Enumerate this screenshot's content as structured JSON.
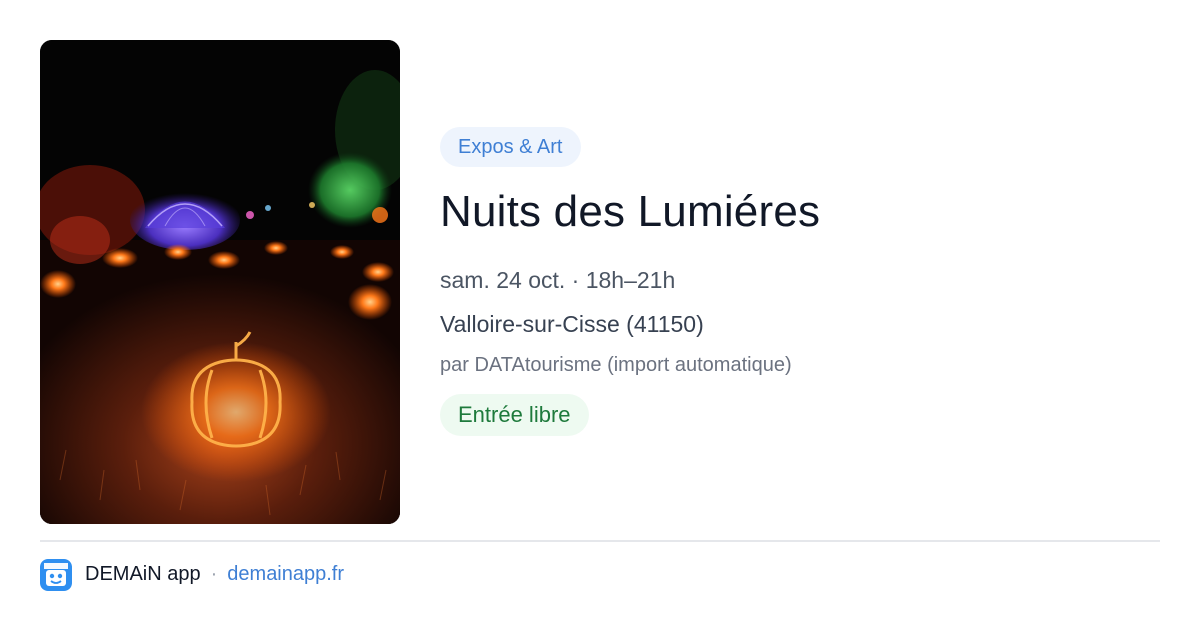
{
  "event": {
    "category": "Expos & Art",
    "title": "Nuits des Lumiéres",
    "datetime": "sam. 24 oct. · 18h–21h",
    "location": "Valloire-sur-Cisse (41150)",
    "source": "par DATAtourisme (import automatique)",
    "price": "Entrée libre",
    "image_icon": "illuminated-pumpkin-photo"
  },
  "footer": {
    "app_name": "DEMAiN app",
    "separator": "·",
    "url": "demainapp.fr",
    "logo_icon": "demain-logo-icon"
  },
  "colors": {
    "accent_blue": "#3f7fd4",
    "category_bg": "#eef4fd",
    "price_green": "#1e7a3c",
    "price_bg": "#eefaf1",
    "title": "#111827",
    "muted": "#6b7280"
  }
}
